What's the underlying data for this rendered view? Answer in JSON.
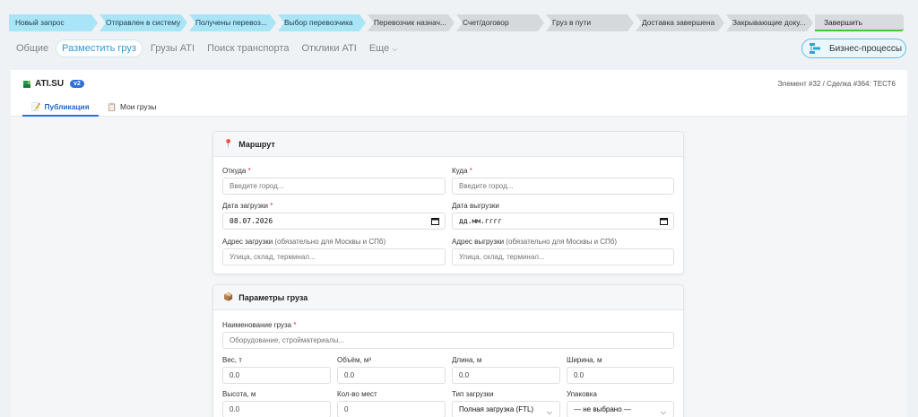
{
  "pipeline": [
    {
      "label": "Новый запрос",
      "state": "active",
      "w": 99
    },
    {
      "label": "Отправлен в систему",
      "state": "active",
      "w": 98
    },
    {
      "label": "Получены перевоз...",
      "state": "active",
      "w": 97
    },
    {
      "label": "Выбор перевозчика",
      "state": "active",
      "w": 98
    },
    {
      "label": "Перевозчик назнач...",
      "state": "inactive",
      "w": 97
    },
    {
      "label": "Счет/договор",
      "state": "inactive",
      "w": 98
    },
    {
      "label": "Груз в пути",
      "state": "inactive",
      "w": 98
    },
    {
      "label": "Доставка завершена",
      "state": "inactive",
      "w": 99
    },
    {
      "label": "Закрывающие доку...",
      "state": "inactive",
      "w": 97
    }
  ],
  "pipeline_finish": "Завершить",
  "nav_tabs": [
    "Общие",
    "Разместить груз",
    "Грузы ATI",
    "Поиск транспорта",
    "Отклики ATI",
    "Еще"
  ],
  "business_processes": "Бизнес-процессы",
  "app": {
    "name": "ATI.SU",
    "version": "v2",
    "crumb": "Элемент #32 / Сделка #364: ТЕСТ6"
  },
  "sub_tabs": {
    "publication": "Публикация",
    "my_cargo": "Мои грузы"
  },
  "route": {
    "title": "Маршрут",
    "from_label": "Откуда",
    "from_placeholder": "Введите город...",
    "to_label": "Куда",
    "to_placeholder": "Введите город...",
    "load_date_label": "Дата загрузки",
    "load_date_value": "08.07.2026",
    "unload_date_label": "Дата выгрузки",
    "unload_date_value": "дд.мм.гггг",
    "load_addr_label": "Адрес загрузки",
    "unload_addr_label": "Адрес выгрузки",
    "addr_hint": "(обязательно для Москвы и СПб)",
    "addr_placeholder": "Улица, склад, терминал...",
    "required": "*"
  },
  "cargo": {
    "title": "Параметры груза",
    "name_label": "Наименование груза",
    "name_placeholder": "Оборудование, стройматериалы...",
    "weight_label": "Вес, т",
    "weight_value": "0.0",
    "volume_label": "Объём, м³",
    "volume_value": "0.0",
    "length_label": "Длина, м",
    "length_value": "0.0",
    "width_label": "Ширина, м",
    "width_value": "0.0",
    "height_label": "Высота, м",
    "height_value": "0.0",
    "places_label": "Кол-во мест",
    "places_value": "0",
    "load_type_label": "Тип загрузки",
    "load_type_value": "Полная загрузка (FTL)",
    "package_label": "Упаковка",
    "package_value": "— не выбрано —"
  }
}
